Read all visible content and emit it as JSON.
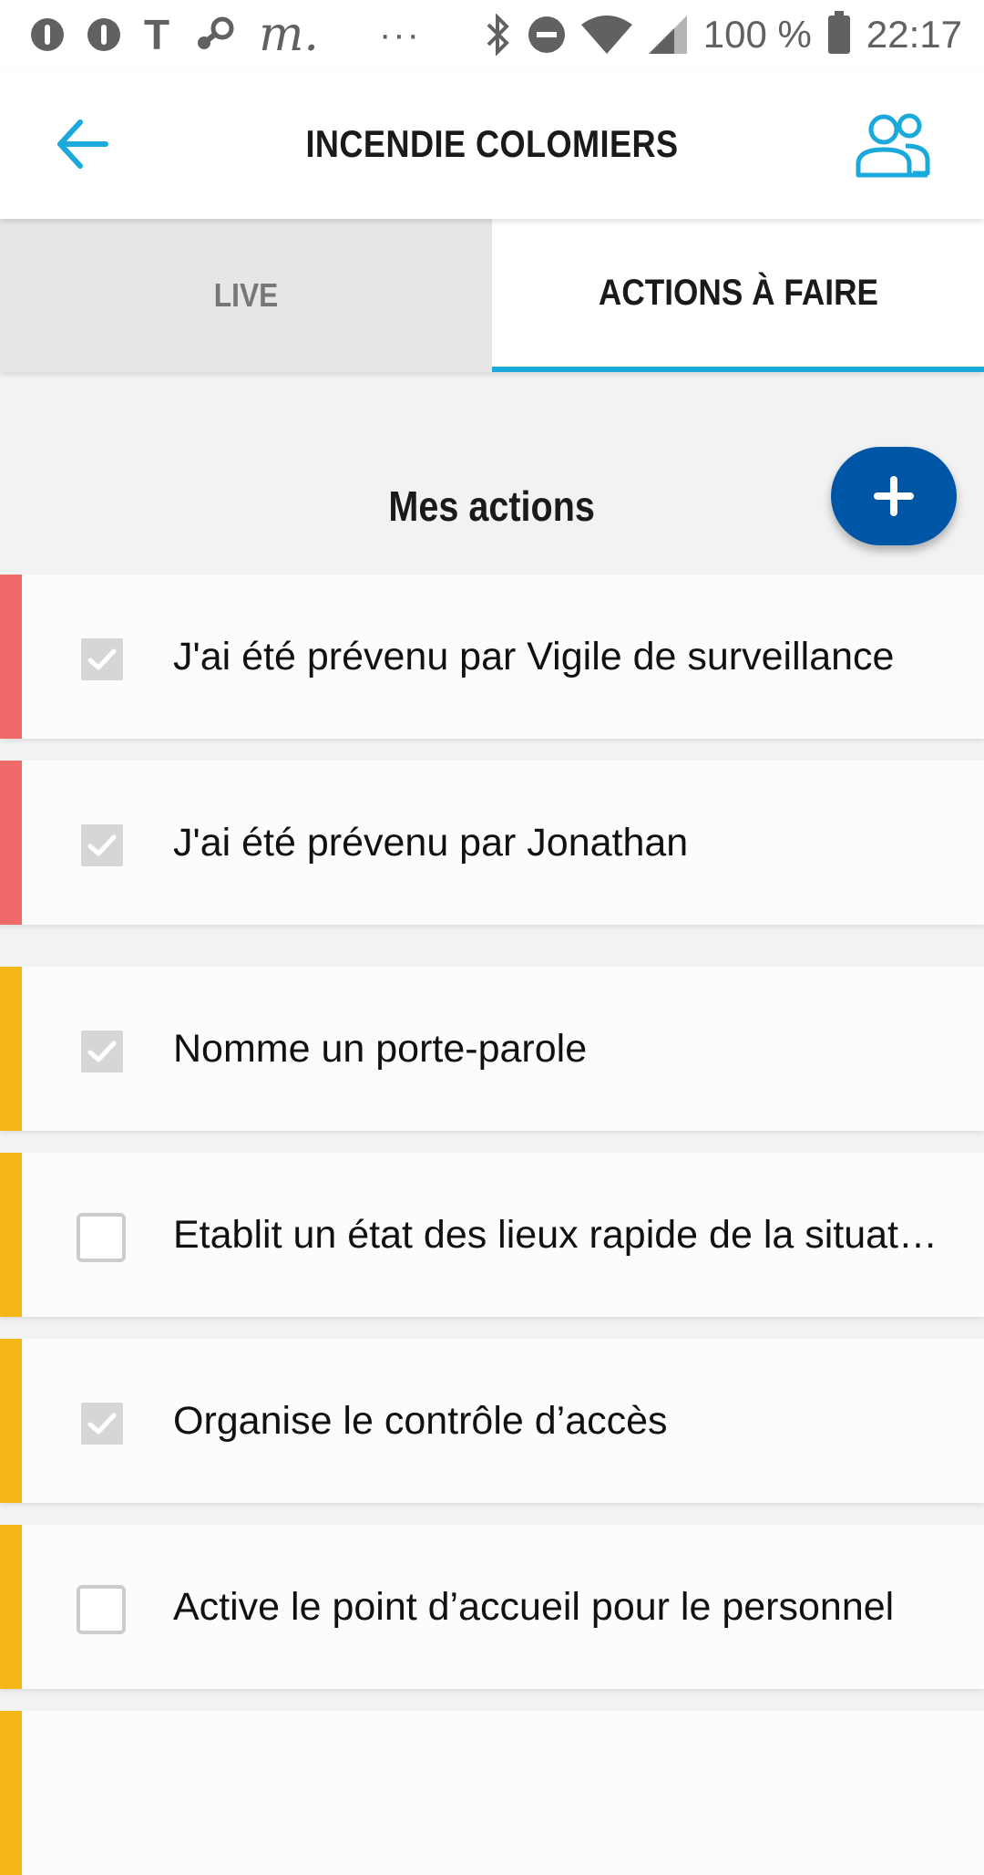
{
  "status_bar": {
    "icons": [
      "alert-icon",
      "alert-icon",
      "t-icon",
      "steam-icon",
      "m-icon"
    ],
    "more": "···",
    "battery_percent": "100 %",
    "time": "22:17"
  },
  "header": {
    "title": "INCENDIE COLOMIERS",
    "back_icon": "arrow-left-icon",
    "members_icon": "people-icon",
    "accent_color": "#1ba9dc"
  },
  "tabs": [
    {
      "label": "LIVE",
      "active": false
    },
    {
      "label": "ACTIONS À FAIRE",
      "active": true
    }
  ],
  "section": {
    "title": "Mes actions",
    "add_button": {
      "icon": "plus-icon",
      "color": "#0056a6"
    }
  },
  "actions": [
    {
      "label": "J'ai été prévenu par Vigile de surveillance",
      "checked": true,
      "priority_color": "#f06a6a"
    },
    {
      "label": "J'ai été prévenu par Jonathan",
      "checked": true,
      "priority_color": "#f06a6a"
    },
    {
      "label": "Nomme un porte-parole",
      "checked": true,
      "priority_color": "#f5b618"
    },
    {
      "label": "Etablit un état des lieux rapide de la situation",
      "checked": false,
      "priority_color": "#f5b618"
    },
    {
      "label": "Organise le contrôle d’accès",
      "checked": true,
      "priority_color": "#f5b618"
    },
    {
      "label": "Active le point d’accueil pour le personnel",
      "checked": false,
      "priority_color": "#f5b618"
    }
  ]
}
